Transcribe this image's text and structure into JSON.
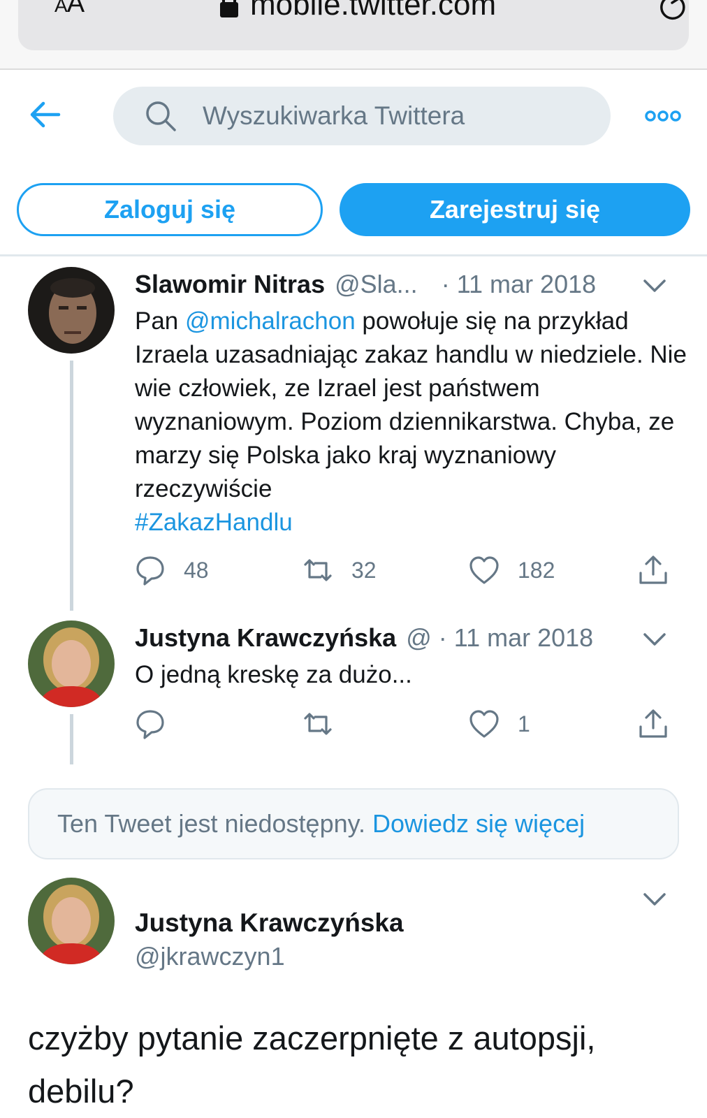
{
  "browser": {
    "text_size_label_small": "A",
    "text_size_label_large": "A",
    "url": "mobile.twitter.com"
  },
  "header": {
    "search_placeholder": "Wyszukiwarka Twittera",
    "login_label": "Zaloguj się",
    "signup_label": "Zarejestruj się"
  },
  "colors": {
    "accent": "#1da1f2",
    "link": "#1b95e0",
    "muted": "#657786",
    "search_bg": "#e6ecf0",
    "thread_line": "#ccd6dd"
  },
  "tweets": [
    {
      "name": "Slawomir Nitras",
      "handle": "@Sla...",
      "date": "11 mar 2018",
      "text_before": "Pan ",
      "mention": "@michalrachon",
      "text_after": " powołuje się na przykład Izraela uzasadniając zakaz handlu w niedziele. Nie wie człowiek, ze Izrael jest państwem wyznaniowym. Poziom dziennikarstwa. Chyba, ze marzy się Polska jako kraj wyznaniowy rzeczywiście",
      "hashtag": "#ZakazHandlu",
      "replies": "48",
      "retweets": "32",
      "likes": "182"
    },
    {
      "name": "Justyna Krawczyńska",
      "handle": "@",
      "date": "11 mar 2018",
      "text": "O jedną kreskę za dużo...",
      "replies": "",
      "retweets": "",
      "likes": "1"
    }
  ],
  "unavailable": {
    "text": "Ten Tweet jest niedostępny.",
    "link": "Dowiedz się więcej"
  },
  "main_tweet": {
    "name": "Justyna Krawczyńska",
    "handle": "@jkrawczyn1",
    "text": "czyżby pytanie zaczerpnięte z autopsji, debilu?"
  }
}
